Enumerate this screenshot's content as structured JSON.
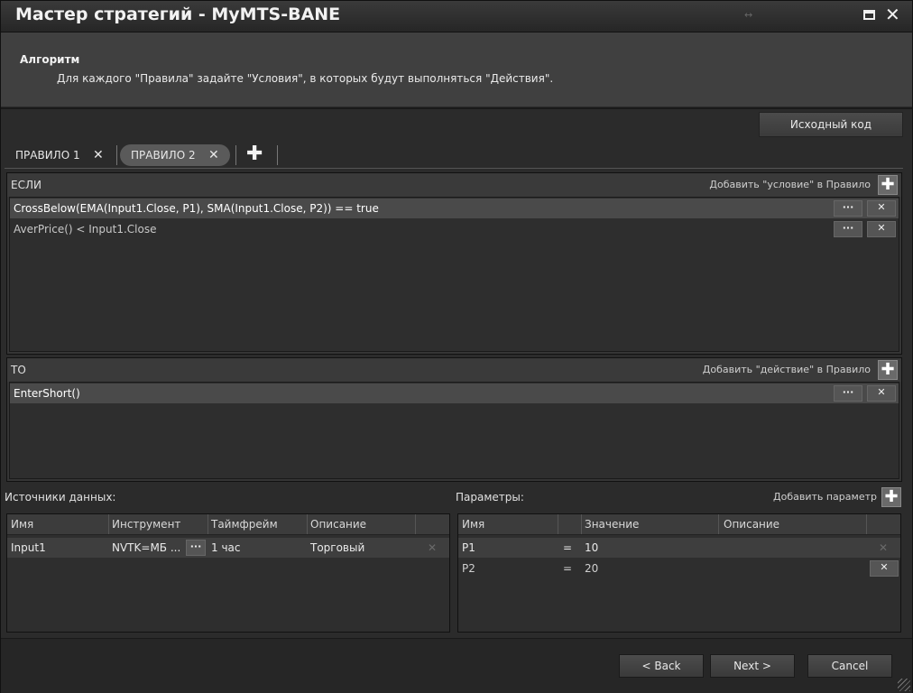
{
  "window": {
    "title": "Мастер стратегий - MyMTS-BANE",
    "resize_glyph": "↔"
  },
  "header": {
    "title": "Алгоритм",
    "description": "Для каждого \"Правила\" задайте \"Условия\", в которых будут выполняться \"Действия\"."
  },
  "source_button": "Исходный код",
  "tabs": [
    {
      "label": "ПРАВИЛО 1",
      "close": "✕"
    },
    {
      "label": "ПРАВИЛО 2",
      "close": "✕",
      "active": true
    }
  ],
  "tab_add": "✚",
  "if_panel": {
    "label": "ЕСЛИ",
    "add_label": "Добавить \"условие\" в Правило",
    "add_glyph": "✚",
    "rows": [
      {
        "text": "CrossBelow(EMA(Input1.Close, P1), SMA(Input1.Close, P2)) == true",
        "dots": "···",
        "del": "✕"
      },
      {
        "text": "AverPrice() < Input1.Close",
        "dots": "···",
        "del": "✕"
      }
    ]
  },
  "then_panel": {
    "label": "ТО",
    "add_label": "Добавить \"действие\" в Правило",
    "add_glyph": "✚",
    "rows": [
      {
        "text": "EnterShort()",
        "dots": "···",
        "del": "✕"
      }
    ]
  },
  "data_sources": {
    "label": "Источники данных:",
    "columns": [
      "Имя",
      "Инструмент",
      "Таймфрейм",
      "Описание"
    ],
    "rows": [
      {
        "name": "Input1",
        "instrument": "NVTK=МБ ...",
        "dots": "···",
        "timeframe": "1 час",
        "description": "Торговый",
        "del": "✕"
      }
    ]
  },
  "parameters": {
    "label": "Параметры:",
    "add_label": "Добавить параметр",
    "add_glyph": "✚",
    "columns": [
      "Имя",
      "Значение",
      "Описание"
    ],
    "rows": [
      {
        "name": "P1",
        "eq": "=",
        "value": "10",
        "del": "✕"
      },
      {
        "name": "P2",
        "eq": "=",
        "value": "20",
        "del": "✕"
      }
    ]
  },
  "footer": {
    "back": "< Back",
    "next": "Next >",
    "cancel": "Cancel"
  },
  "colors": {
    "background": "#2b2b2b",
    "panel": "#353535",
    "selected_row": "#4a4a4a"
  },
  "icons": {
    "maximize": "maximize-icon",
    "close": "close-icon",
    "add": "plus-icon",
    "delete": "close-icon",
    "more": "ellipsis-icon"
  }
}
